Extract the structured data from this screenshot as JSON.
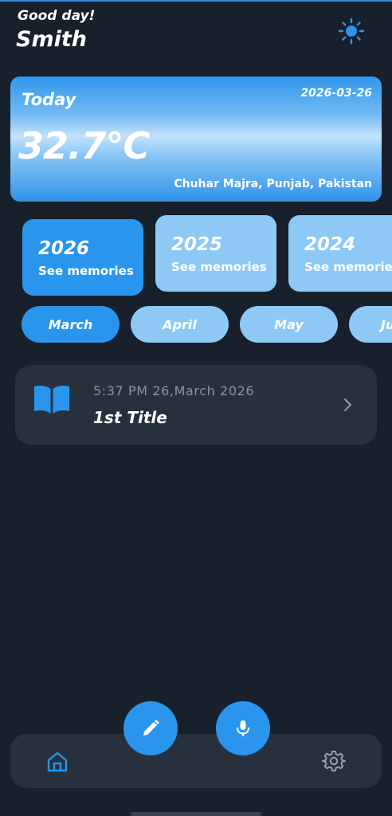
{
  "header": {
    "greeting": "Good day!",
    "user_name": "Smith",
    "theme_icon": "sun-icon"
  },
  "weather": {
    "label": "Today",
    "date": "2026-03-26",
    "temperature": "32.7°C",
    "location": "Chuhar Majra, Punjab, Pakistan"
  },
  "years": [
    {
      "year": "2026",
      "subtitle": "See memories",
      "selected": true
    },
    {
      "year": "2025",
      "subtitle": "See memories",
      "selected": false
    },
    {
      "year": "2024",
      "subtitle": "See memories",
      "selected": false
    }
  ],
  "months": [
    {
      "label": "March",
      "selected": true
    },
    {
      "label": "April",
      "selected": false
    },
    {
      "label": "May",
      "selected": false
    },
    {
      "label": "June",
      "selected": false
    }
  ],
  "entries": [
    {
      "timestamp": "5:37 PM 26,March 2026",
      "title": "1st Title",
      "icon": "book-icon"
    }
  ],
  "actions": {
    "write": "pencil-icon",
    "record": "microphone-icon"
  },
  "bottom_nav": {
    "home": "home-icon",
    "settings": "gear-icon"
  },
  "colors": {
    "background": "#17202b",
    "accent": "#2a95ec",
    "light_accent": "#8ec9f6",
    "card": "#27313e"
  }
}
